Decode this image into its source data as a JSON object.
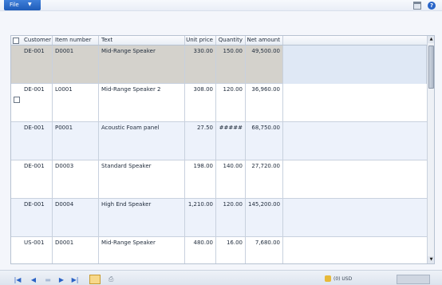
{
  "toolbar": {
    "file_label": "File"
  },
  "grid": {
    "columns": [
      "Customer",
      "Item number",
      "Text",
      "Unit price",
      "Quantity",
      "Net amount"
    ],
    "rows": [
      {
        "customer": "DE-001",
        "item": "D0001",
        "text": "Mid-Range Speaker",
        "unit_price": "330.00",
        "quantity": "150.00",
        "net_amount": "49,500.00"
      },
      {
        "customer": "DE-001",
        "item": "L0001",
        "text": "Mid-Range Speaker 2",
        "unit_price": "308.00",
        "quantity": "120.00",
        "net_amount": "36,960.00"
      },
      {
        "customer": "DE-001",
        "item": "P0001",
        "text": "Acoustic Foam panel",
        "unit_price": "27.50",
        "quantity": "#####",
        "net_amount": "68,750.00"
      },
      {
        "customer": "DE-001",
        "item": "D0003",
        "text": "Standard Speaker",
        "unit_price": "198.00",
        "quantity": "140.00",
        "net_amount": "27,720.00"
      },
      {
        "customer": "DE-001",
        "item": "D0004",
        "text": "High End Speaker",
        "unit_price": "1,210.00",
        "quantity": "120.00",
        "net_amount": "145,200.00"
      },
      {
        "customer": "US-001",
        "item": "D0001",
        "text": "Mid-Range Speaker",
        "unit_price": "480.00",
        "quantity": "16.00",
        "net_amount": "7,680.00"
      }
    ]
  },
  "statusbar": {
    "left_text": "",
    "right_text": "(0)  USD"
  },
  "colors": {
    "accent": "#2a63c7",
    "selected_row": "#d4d2cc",
    "alt_row": "#edf2fb"
  }
}
